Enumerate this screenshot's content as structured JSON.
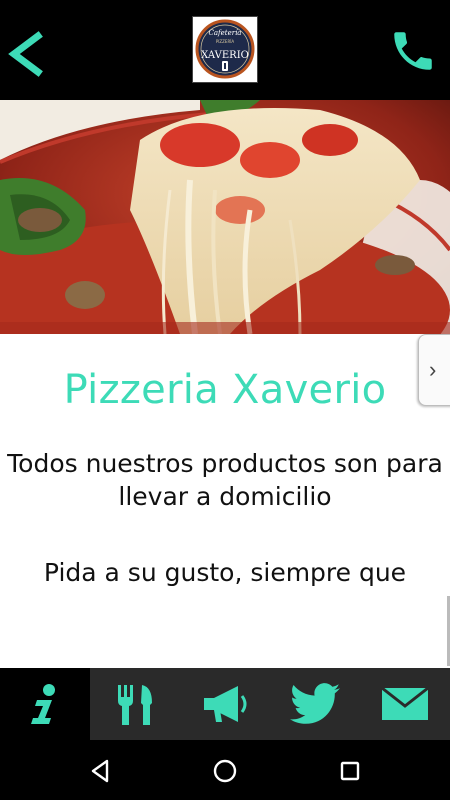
{
  "header": {
    "back_icon": "chevron-left-icon",
    "phone_icon": "phone-icon",
    "logo": {
      "line1": "Cafetería",
      "line2": "PIZZERÍA",
      "name": "XAVERIO"
    },
    "accent_color": "#3ddbb7"
  },
  "content": {
    "title": "Pizzeria Xaverio",
    "paragraph1": "Todos nuestros productos son para llevar a domicilio",
    "paragraph2": "Pida a su gusto, siempre que",
    "side_tab_label": "›"
  },
  "tabbar": {
    "items": [
      {
        "icon": "info-icon",
        "active": true
      },
      {
        "icon": "fork-knife-icon",
        "active": false
      },
      {
        "icon": "megaphone-icon",
        "active": false
      },
      {
        "icon": "twitter-icon",
        "active": false
      },
      {
        "icon": "mail-icon",
        "active": false
      }
    ]
  },
  "navbar": {
    "icons": [
      "back-triangle-icon",
      "home-circle-icon",
      "recents-square-icon"
    ]
  }
}
